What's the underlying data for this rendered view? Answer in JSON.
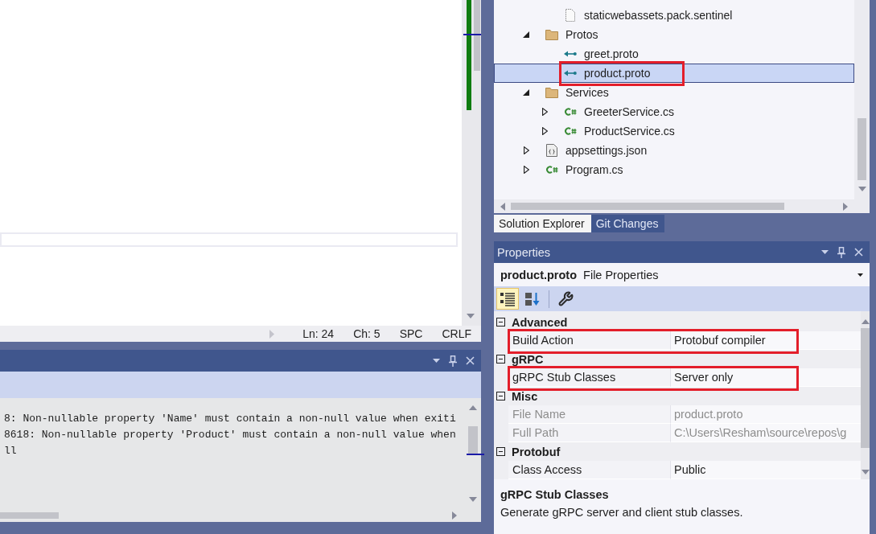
{
  "editor": {
    "status_bar": [
      "Ln: 24",
      "Ch: 5",
      "SPC",
      "CRLF"
    ]
  },
  "output": {
    "lines": [
      "8: Non-nullable property 'Name' must contain a non-null value when exiti",
      "8618: Non-nullable property 'Product' must contain a non-null value when",
      "ll"
    ]
  },
  "solution_explorer": {
    "tree": [
      {
        "children": [
          {
            "kind": "file",
            "label": "staticwebassets.pack.sentinel",
            "selected": false,
            "annotated": false
          }
        ]
      },
      {
        "kind": "folder",
        "label": "Protos",
        "expanded": true,
        "selected": false,
        "annotated": false,
        "children": [
          {
            "kind": "proto",
            "label": "greet.proto",
            "selected": false,
            "annotated": false
          },
          {
            "kind": "proto",
            "label": "product.proto",
            "selected": true,
            "annotated": true
          }
        ]
      },
      {
        "kind": "folder",
        "label": "Services",
        "expanded": true,
        "selected": false,
        "annotated": false,
        "children": [
          {
            "kind": "csharp",
            "label": "GreeterService.cs",
            "expanded": false,
            "selected": false,
            "annotated": false
          },
          {
            "kind": "csharp",
            "label": "ProductService.cs",
            "expanded": false,
            "selected": false,
            "annotated": false
          }
        ]
      },
      {
        "kind": "json",
        "label": "appsettings.json",
        "expanded": false,
        "selected": false,
        "annotated": false
      },
      {
        "kind": "csharp",
        "label": "Program.cs",
        "expanded": false,
        "selected": false,
        "annotated": false
      }
    ],
    "tabs": [
      {
        "label": "Solution Explorer",
        "selected": true
      },
      {
        "label": "Git Changes",
        "selected": false
      }
    ]
  },
  "properties": {
    "title": "Properties",
    "object_name": "product.proto",
    "object_type": "File Properties",
    "view_buttons": [
      {
        "selected": true
      },
      {
        "selected": false
      }
    ],
    "categories": [
      {
        "label": "Advanced",
        "expanded": true,
        "properties": [
          {
            "name": "Build Action",
            "value": "Protobuf compiler",
            "disabled": false,
            "annotated": true
          }
        ]
      },
      {
        "label": "gRPC",
        "expanded": true,
        "properties": [
          {
            "name": "gRPC Stub Classes",
            "value": "Server only",
            "disabled": false,
            "annotated": true
          }
        ]
      },
      {
        "label": "Misc",
        "expanded": true,
        "properties": [
          {
            "name": "File Name",
            "value": "product.proto",
            "disabled": true,
            "annotated": false
          },
          {
            "name": "Full Path",
            "value": "C:\\Users\\Resham\\source\\repos\\g",
            "disabled": true,
            "annotated": false
          }
        ]
      },
      {
        "label": "Protobuf",
        "expanded": true,
        "properties": [
          {
            "name": "Class Access",
            "value": "Public",
            "disabled": false,
            "annotated": false
          }
        ]
      }
    ],
    "description": {
      "title": "gRPC Stub Classes",
      "text": "Generate gRPC server and client stub classes."
    }
  }
}
